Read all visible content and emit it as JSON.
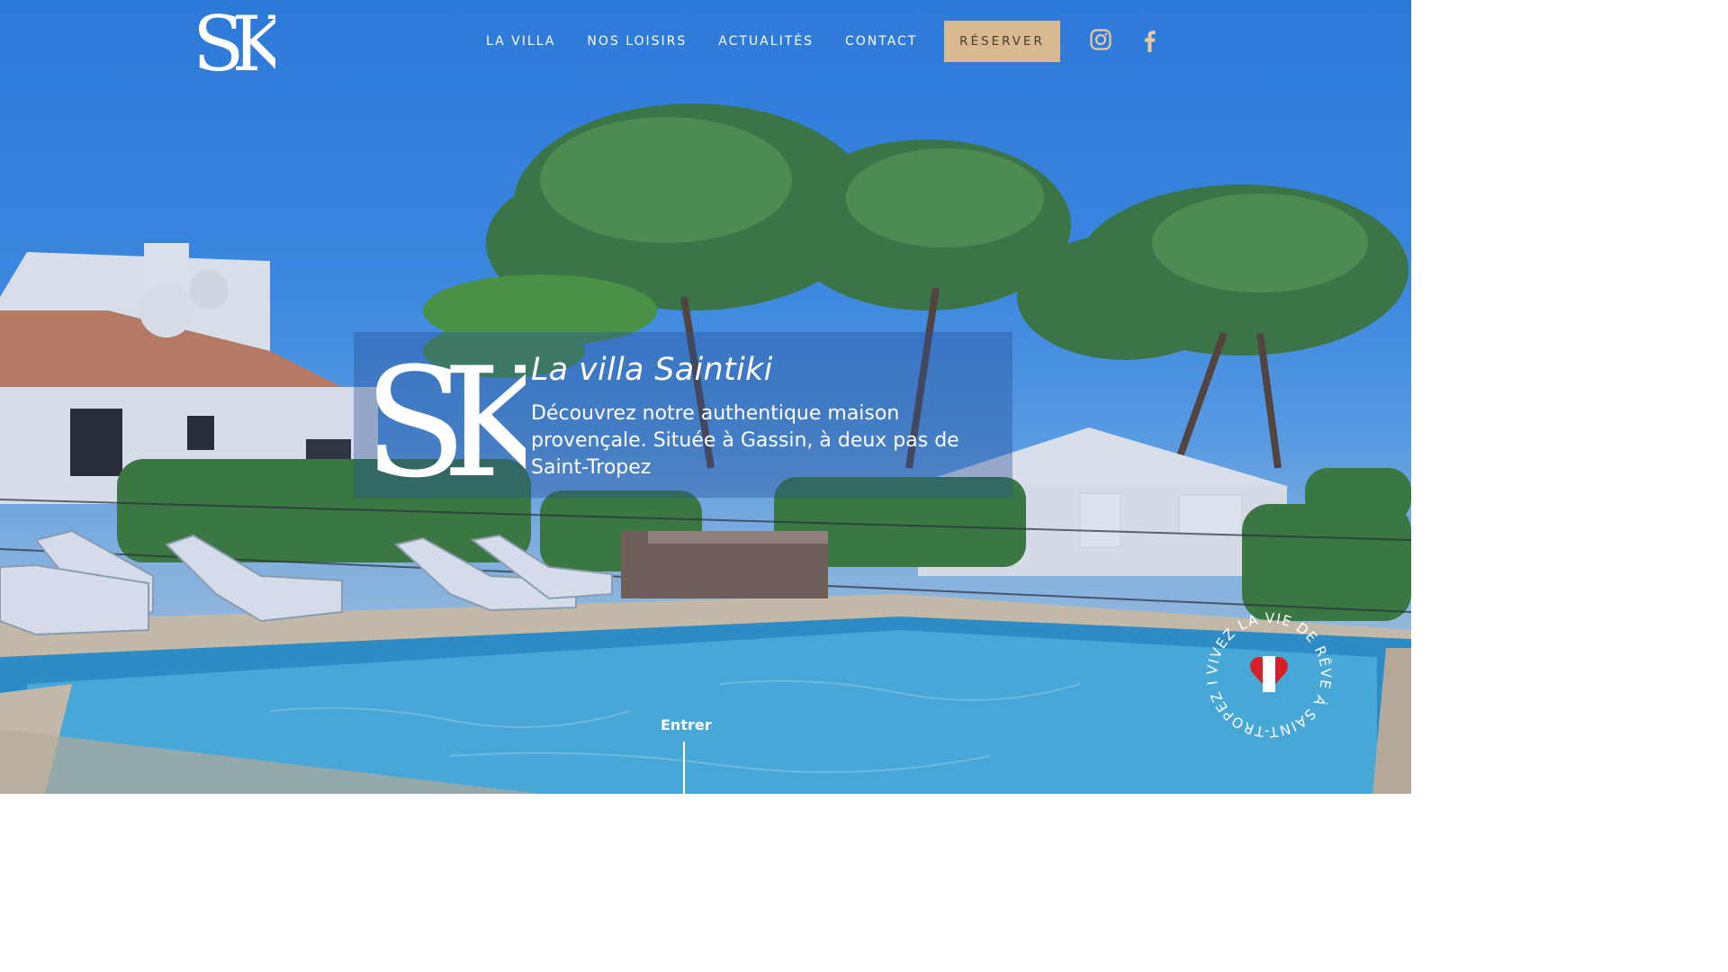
{
  "header": {
    "logo_text": "SK",
    "nav": [
      {
        "label": "LA VILLA"
      },
      {
        "label": "NOS LOISIRS"
      },
      {
        "label": "ACTUALITÉS"
      },
      {
        "label": "CONTACT"
      }
    ],
    "reserve_label": "RÉSERVER",
    "social": [
      {
        "icon": "instagram-icon"
      },
      {
        "icon": "facebook-icon"
      }
    ],
    "accent_color": "#d9b98f"
  },
  "hero": {
    "logo_text": "SK",
    "title": "La villa Saintiki",
    "description": "Découvrez notre authentique maison provençale. Située à Gassin, à deux pas de Saint-Tropez",
    "enter_label": "Entrer"
  },
  "badge": {
    "text": "VIVEZ LA VIE DE RÊVE À SAINT-TROPEZ I ",
    "icon": "heart-icon"
  }
}
